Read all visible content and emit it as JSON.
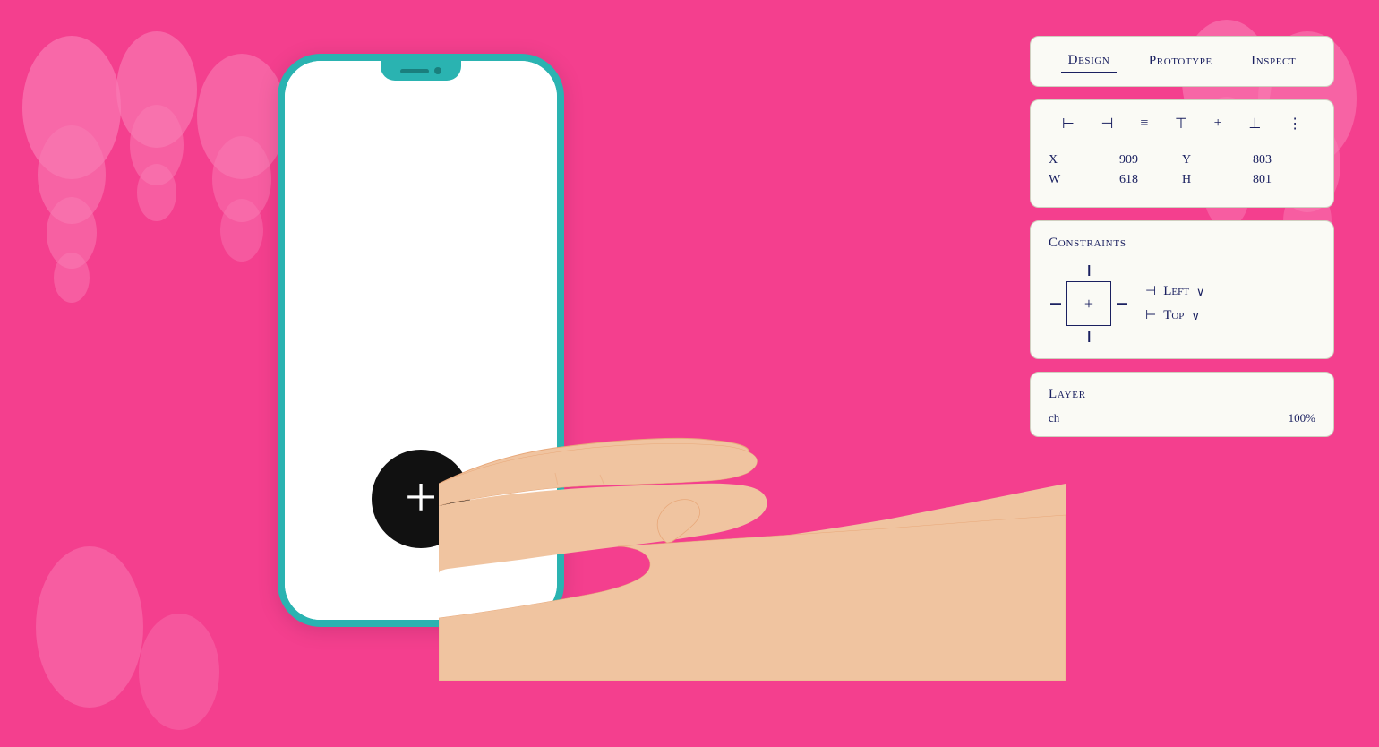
{
  "background": {
    "color": "#f43f8e"
  },
  "tabs": {
    "items": [
      {
        "label": "Design",
        "active": true
      },
      {
        "label": "Prototype",
        "active": false
      },
      {
        "label": "Inspect",
        "active": false
      }
    ]
  },
  "alignment_icons": [
    "⊢",
    "⊣",
    "⊥",
    "⊤",
    "↔",
    "↕",
    "⋮"
  ],
  "dimensions": {
    "x_label": "X",
    "x_value": "909",
    "y_label": "Y",
    "y_value": "803",
    "w_label": "W",
    "w_value": "618",
    "h_label": "H",
    "h_value": "801"
  },
  "constraints": {
    "title": "Constraints",
    "left_label": "Left",
    "left_dropdown": "∨",
    "top_label": "Top",
    "top_dropdown": "∨"
  },
  "layer": {
    "title": "Layer",
    "row_label": "ch",
    "row_value": "100%"
  }
}
